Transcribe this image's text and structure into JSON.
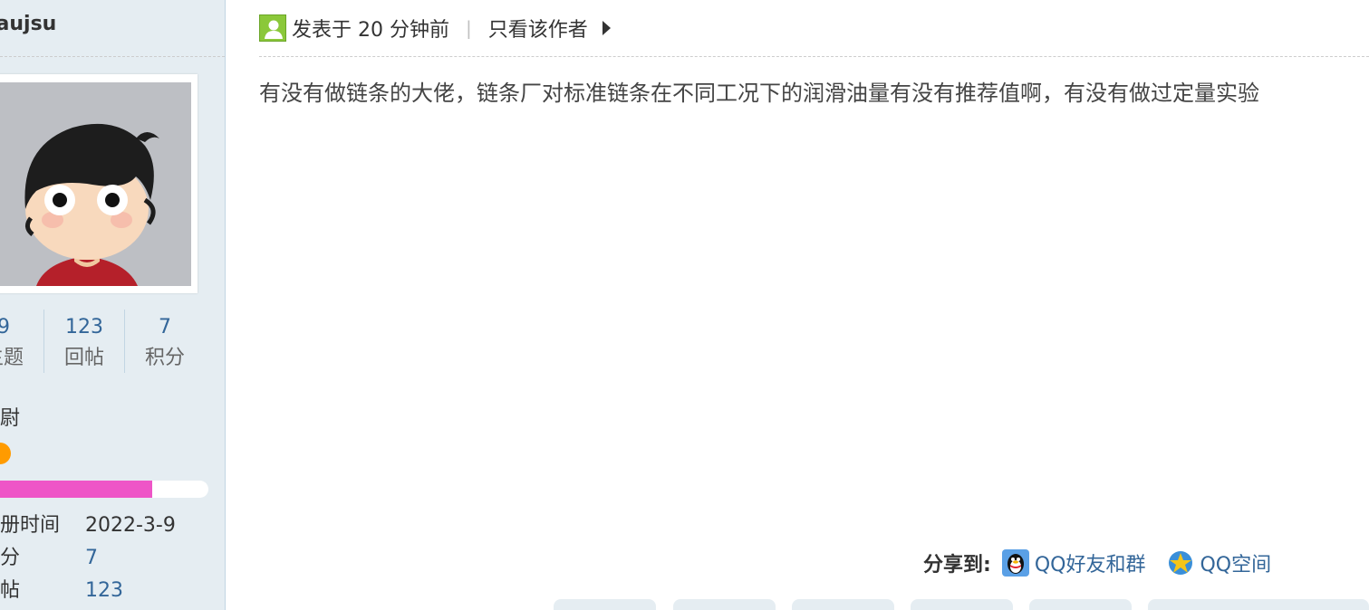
{
  "user": {
    "username": "laujsu",
    "stats": [
      {
        "num": "9",
        "label": "主题"
      },
      {
        "num": "123",
        "label": "回帖"
      },
      {
        "num": "7",
        "label": "积分"
      }
    ],
    "rank_title": "中尉",
    "rank_progress": 0.74,
    "info": [
      {
        "key": "注册时间",
        "value": "2022-3-9"
      },
      {
        "key": "积分",
        "value": "7"
      },
      {
        "key": "回帖",
        "value": "123"
      }
    ]
  },
  "post": {
    "posted_time": "发表于 20 分钟前",
    "only_author": "只看该作者",
    "content": "有没有做链条的大佬，链条厂对标准链条在不同工况下的润滑油量有没有推荐值啊，有没有做过定量实验"
  },
  "share": {
    "label": "分享到:",
    "qq_friends": "QQ好友和群",
    "qzone": "QQ空间"
  },
  "colors": {
    "sidebar_bg": "#e5edf2",
    "link": "#336699",
    "rank_bar": "#ee55c7",
    "rank_dot": "#ff9b00"
  }
}
